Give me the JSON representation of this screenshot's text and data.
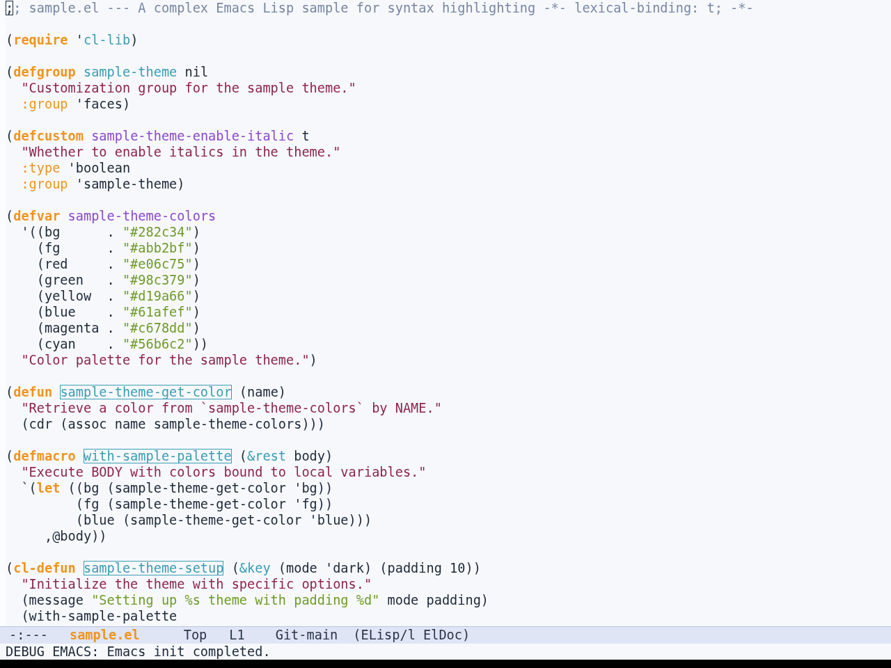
{
  "buffer": {
    "blocks": [
      {
        "lines": [
          {
            "tokens": [
              {
                "text": ";",
                "kind": "cursor"
              },
              {
                "text": "; sample.el --- A complex Emacs Lisp sample for syntax highlighting -*- lexical-binding: t; -*-",
                "kind": "comment"
              }
            ]
          }
        ]
      },
      {
        "lines": [
          {
            "tokens": [
              {
                "text": "(",
                "kind": "plain"
              },
              {
                "text": "require",
                "kind": "keyword"
              },
              {
                "text": " '",
                "kind": "plain"
              },
              {
                "text": "cl-lib",
                "kind": "constant"
              },
              {
                "text": ")",
                "kind": "plain"
              }
            ]
          }
        ]
      },
      {
        "lines": [
          {
            "tokens": [
              {
                "text": "(",
                "kind": "plain"
              },
              {
                "text": "defgroup ",
                "kind": "keyword"
              },
              {
                "text": "sample-theme",
                "kind": "constant"
              },
              {
                "text": " nil",
                "kind": "plain"
              }
            ]
          },
          {
            "tokens": [
              {
                "text": "  \"Customization group for the sample theme.\"",
                "kind": "doc"
              }
            ]
          },
          {
            "tokens": [
              {
                "text": "  :group",
                "kind": "builtin"
              },
              {
                "text": " 'faces)",
                "kind": "plain"
              }
            ]
          }
        ]
      },
      {
        "lines": [
          {
            "tokens": [
              {
                "text": "(",
                "kind": "plain"
              },
              {
                "text": "defcustom ",
                "kind": "keyword"
              },
              {
                "text": "sample-theme-enable-italic",
                "kind": "variable"
              },
              {
                "text": " t",
                "kind": "plain"
              }
            ]
          },
          {
            "tokens": [
              {
                "text": "  \"Whether to enable italics in the theme.\"",
                "kind": "doc"
              }
            ]
          },
          {
            "tokens": [
              {
                "text": "  :type",
                "kind": "builtin"
              },
              {
                "text": " 'boolean",
                "kind": "plain"
              }
            ]
          },
          {
            "tokens": [
              {
                "text": "  :group",
                "kind": "builtin"
              },
              {
                "text": " 'sample-theme)",
                "kind": "plain"
              }
            ]
          }
        ]
      },
      {
        "lines": [
          {
            "tokens": [
              {
                "text": "(",
                "kind": "plain"
              },
              {
                "text": "defvar ",
                "kind": "keyword"
              },
              {
                "text": "sample-theme-colors",
                "kind": "variable"
              }
            ]
          },
          {
            "tokens": [
              {
                "text": "  '((bg      . ",
                "kind": "plain"
              },
              {
                "text": "\"#282c34\"",
                "kind": "string"
              },
              {
                "text": ")",
                "kind": "plain"
              }
            ]
          },
          {
            "tokens": [
              {
                "text": "    (fg      . ",
                "kind": "plain"
              },
              {
                "text": "\"#abb2bf\"",
                "kind": "string"
              },
              {
                "text": ")",
                "kind": "plain"
              }
            ]
          },
          {
            "tokens": [
              {
                "text": "    (red     . ",
                "kind": "plain"
              },
              {
                "text": "\"#e06c75\"",
                "kind": "string"
              },
              {
                "text": ")",
                "kind": "plain"
              }
            ]
          },
          {
            "tokens": [
              {
                "text": "    (green   . ",
                "kind": "plain"
              },
              {
                "text": "\"#98c379\"",
                "kind": "string"
              },
              {
                "text": ")",
                "kind": "plain"
              }
            ]
          },
          {
            "tokens": [
              {
                "text": "    (yellow  . ",
                "kind": "plain"
              },
              {
                "text": "\"#d19a66\"",
                "kind": "string"
              },
              {
                "text": ")",
                "kind": "plain"
              }
            ]
          },
          {
            "tokens": [
              {
                "text": "    (blue    . ",
                "kind": "plain"
              },
              {
                "text": "\"#61afef\"",
                "kind": "string"
              },
              {
                "text": ")",
                "kind": "plain"
              }
            ]
          },
          {
            "tokens": [
              {
                "text": "    (magenta . ",
                "kind": "plain"
              },
              {
                "text": "\"#c678dd\"",
                "kind": "string"
              },
              {
                "text": ")",
                "kind": "plain"
              }
            ]
          },
          {
            "tokens": [
              {
                "text": "    (cyan    . ",
                "kind": "plain"
              },
              {
                "text": "\"#56b6c2\"",
                "kind": "string"
              },
              {
                "text": "))",
                "kind": "plain"
              }
            ]
          },
          {
            "tokens": [
              {
                "text": "  \"Color palette for the sample theme.\"",
                "kind": "doc"
              },
              {
                "text": ")",
                "kind": "plain"
              }
            ]
          }
        ]
      },
      {
        "lines": [
          {
            "tokens": [
              {
                "text": "(",
                "kind": "plain"
              },
              {
                "text": "defun ",
                "kind": "keyword"
              },
              {
                "text": "sample-theme-get-color",
                "kind": "function"
              },
              {
                "text": " (name)",
                "kind": "plain"
              }
            ]
          },
          {
            "tokens": [
              {
                "text": "  \"Retrieve a color from `sample-theme-colors` by NAME.\"",
                "kind": "doc"
              }
            ]
          },
          {
            "tokens": [
              {
                "text": "  (cdr (assoc name sample-theme-colors)))",
                "kind": "plain"
              }
            ]
          }
        ]
      },
      {
        "lines": [
          {
            "tokens": [
              {
                "text": "(",
                "kind": "plain"
              },
              {
                "text": "defmacro ",
                "kind": "keyword"
              },
              {
                "text": "with-sample-palette",
                "kind": "function"
              },
              {
                "text": " (",
                "kind": "plain"
              },
              {
                "text": "&rest",
                "kind": "constant"
              },
              {
                "text": " body)",
                "kind": "plain"
              }
            ]
          },
          {
            "tokens": [
              {
                "text": "  \"Execute BODY with colors bound to local variables.\"",
                "kind": "doc"
              }
            ]
          },
          {
            "tokens": [
              {
                "text": "  `(",
                "kind": "plain"
              },
              {
                "text": "let",
                "kind": "keyword"
              },
              {
                "text": " ((bg (sample-theme-get-color 'bg))",
                "kind": "plain"
              }
            ]
          },
          {
            "tokens": [
              {
                "text": "         (fg (sample-theme-get-color 'fg))",
                "kind": "plain"
              }
            ]
          },
          {
            "tokens": [
              {
                "text": "         (blue (sample-theme-get-color 'blue)))",
                "kind": "plain"
              }
            ]
          },
          {
            "tokens": [
              {
                "text": "     ,@body))",
                "kind": "plain"
              }
            ]
          }
        ]
      },
      {
        "lines": [
          {
            "tokens": [
              {
                "text": "(",
                "kind": "plain"
              },
              {
                "text": "cl-defun ",
                "kind": "keyword"
              },
              {
                "text": "sample-theme-setup",
                "kind": "function"
              },
              {
                "text": " (",
                "kind": "plain"
              },
              {
                "text": "&key",
                "kind": "constant"
              },
              {
                "text": " (mode 'dark) (padding 10))",
                "kind": "plain"
              }
            ]
          },
          {
            "tokens": [
              {
                "text": "  \"Initialize the theme with specific options.\"",
                "kind": "doc"
              }
            ]
          },
          {
            "tokens": [
              {
                "text": "  (message ",
                "kind": "plain"
              },
              {
                "text": "\"Setting up %s theme with padding %d\"",
                "kind": "string"
              },
              {
                "text": " mode padding)",
                "kind": "plain"
              }
            ]
          },
          {
            "tokens": [
              {
                "text": "  (with-sample-palette",
                "kind": "plain"
              }
            ]
          }
        ]
      }
    ]
  },
  "mode_line": {
    "status": "-:---",
    "buffer_name": "sample.el",
    "scroll": "Top",
    "line": "L1",
    "vc_branch": "Git-main",
    "modes": "(ELisp/l ElDoc)"
  },
  "echo_area": {
    "message": "DEBUG EMACS: Emacs init completed."
  }
}
